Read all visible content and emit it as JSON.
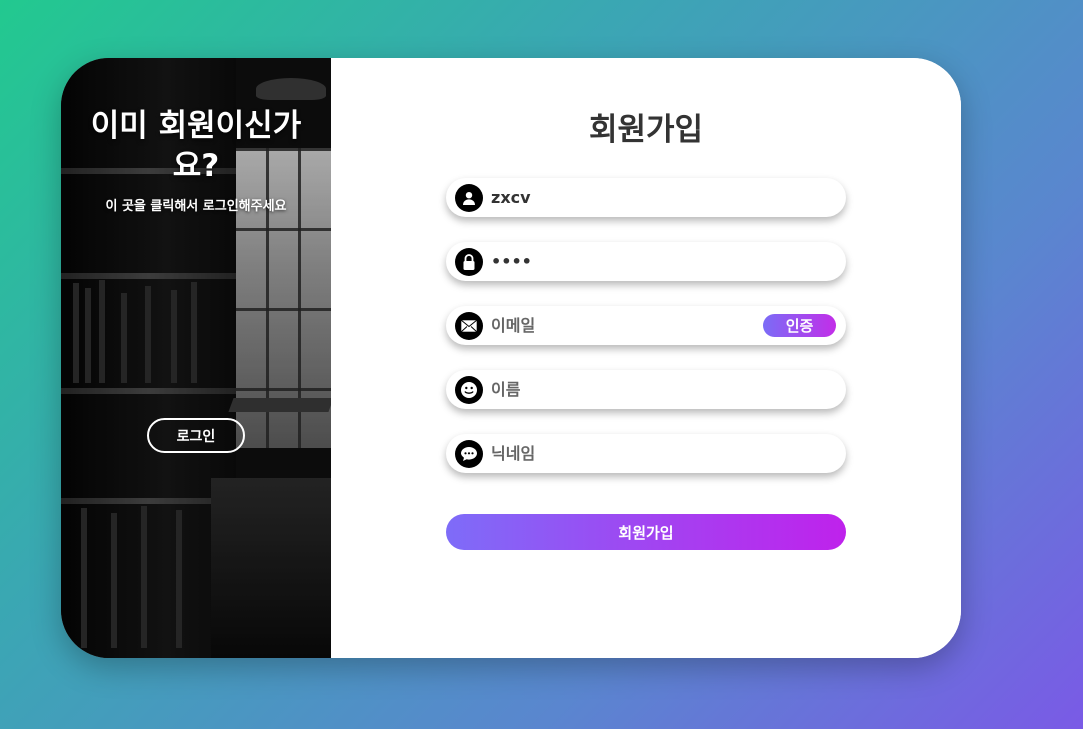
{
  "left_panel": {
    "heading": "이미 회원이신가요?",
    "subtext": "이 곳을 클릭해서 로그인해주세요",
    "login_button": "로그인"
  },
  "form": {
    "title": "회원가입",
    "username": {
      "value": "zxcv",
      "icon": "user-icon"
    },
    "password": {
      "value": "abcd",
      "icon": "lock-icon"
    },
    "email": {
      "placeholder": "이메일",
      "icon": "mail-icon",
      "verify_label": "인증"
    },
    "name": {
      "placeholder": "이름",
      "icon": "smiley-icon"
    },
    "nickname": {
      "placeholder": "닉네임",
      "icon": "chat-bubble-icon"
    },
    "submit_label": "회원가입"
  },
  "colors": {
    "accent_start": "#7b6cf6",
    "accent_end": "#c22ee8"
  }
}
